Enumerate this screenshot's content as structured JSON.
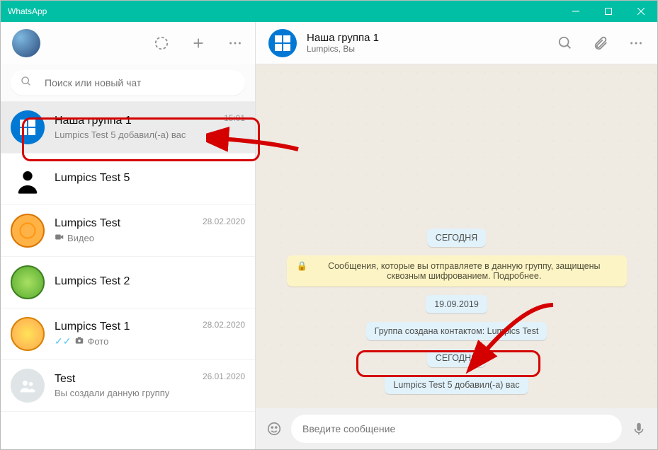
{
  "window": {
    "title": "WhatsApp"
  },
  "search": {
    "placeholder": "Поиск или новый чат"
  },
  "chats": [
    {
      "name": "Наша группа 1",
      "sub": "Lumpics Test 5 добавил(-а) вас",
      "time": "15:01"
    },
    {
      "name": "Lumpics Test 5",
      "sub": "",
      "time": ""
    },
    {
      "name": "Lumpics Test",
      "sub": "Видео",
      "time": "28.02.2020"
    },
    {
      "name": "Lumpics Test 2",
      "sub": "",
      "time": ""
    },
    {
      "name": "Lumpics Test 1",
      "sub": "Фото",
      "time": "28.02.2020"
    },
    {
      "name": "Test",
      "sub": "Вы создали данную группу",
      "time": "26.01.2020"
    }
  ],
  "conversation": {
    "title": "Наша группа 1",
    "subtitle": "Lumpics, Вы",
    "pills": {
      "today1": "СЕГОДНЯ",
      "encryption": "Сообщения, которые вы отправляете в данную группу, защищены сквозным шифрованием. Подробнее.",
      "date": "19.09.2019",
      "created": "Группа создана контактом: Lumpics Test",
      "today2": "СЕГОДНЯ",
      "added": "Lumpics Test 5 добавил(-а) вас"
    }
  },
  "composer": {
    "placeholder": "Введите сообщение"
  }
}
